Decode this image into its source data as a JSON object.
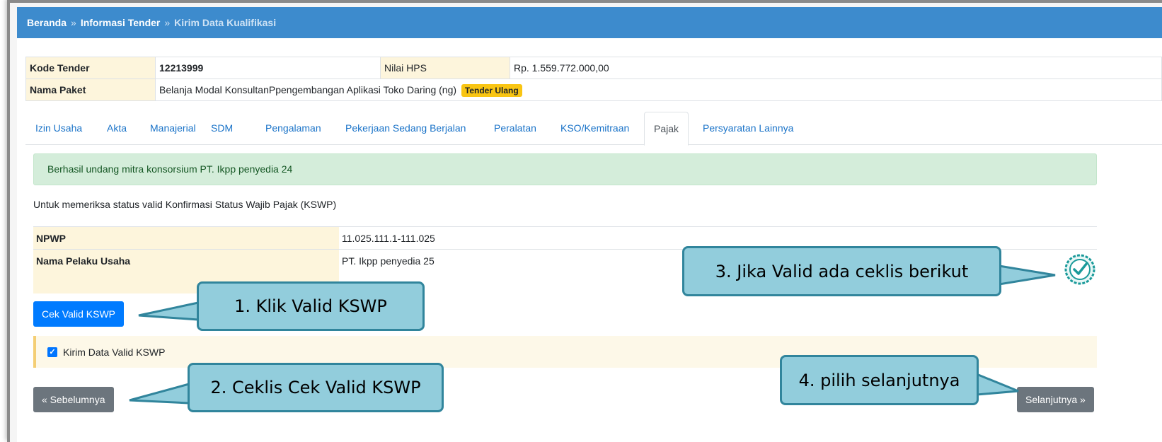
{
  "breadcrumb": {
    "home": "Beranda",
    "sep": "»",
    "info": "Informasi Tender",
    "current": "Kirim Data Kualifikasi"
  },
  "tender": {
    "kode_label": "Kode Tender",
    "kode_value": "12213999",
    "hps_label": "Nilai HPS",
    "hps_value": "Rp. 1.559.772.000,00",
    "paket_label": "Nama Paket",
    "paket_value": "Belanja Modal KonsultanPpengembangan Aplikasi Toko Daring (ng)",
    "badge": "Tender Ulang"
  },
  "tabs": [
    "Izin Usaha",
    "Akta",
    "Manajerial",
    "SDM",
    "Pengalaman",
    "Pekerjaan Sedang Berjalan",
    "Peralatan",
    "KSO/Kemitraan",
    "Pajak",
    "Persyaratan Lainnya"
  ],
  "active_tab": "Pajak",
  "alert": "Berhasil undang mitra konsorsium PT. Ikpp penyedia 24",
  "note": "Untuk memeriksa status valid Konfirmasi Status Wajib Pajak (KSWP)",
  "kswp": {
    "npwp_label": "NPWP",
    "npwp_value": "11.025.111.1-111.025",
    "nama_label": "Nama Pelaku Usaha",
    "nama_value": "PT. Ikpp penyedia 25"
  },
  "buttons": {
    "cek": "Cek Valid KSWP",
    "prev": "« Sebelumnya",
    "next": "Selanjutnya »"
  },
  "checkbox_label": "Kirim Data Valid KSWP",
  "checkbox_checked": true,
  "callouts": {
    "c1": "1. Klik Valid KSWP",
    "c2": "2. Ceklis Cek Valid KSWP",
    "c3": "3. Jika Valid ada ceklis berikut",
    "c4": "4. pilih selanjutnya"
  },
  "colors": {
    "topbar": "#3d8bcd",
    "callout_fill": "#92cddc",
    "callout_border": "#31859c",
    "valid_icon": "#1a9a9a"
  },
  "icons": {
    "valid": "check-circle-icon"
  }
}
